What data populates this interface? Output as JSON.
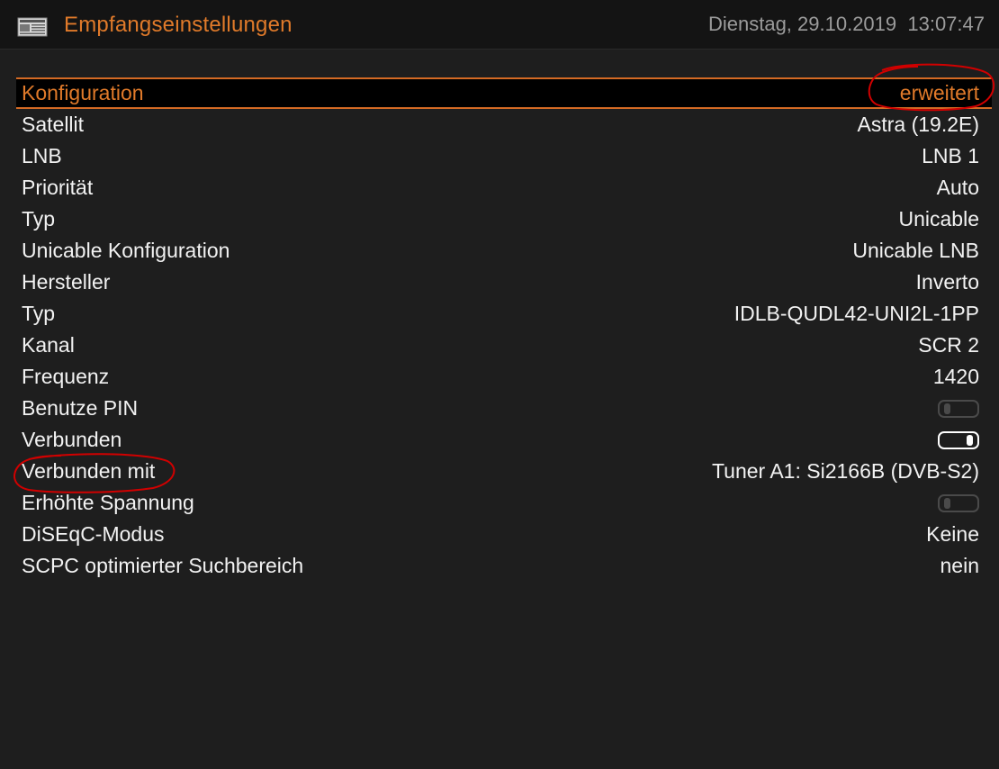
{
  "header": {
    "icon": "newspaper-icon",
    "title": "Empfangseinstellungen",
    "datetime": "Dienstag, 29.10.2019  13:07:47"
  },
  "colors": {
    "accent": "#e07a2a",
    "annotation": "#d10000",
    "background": "#1e1e1e"
  },
  "settings": [
    {
      "label": "Konfiguration",
      "value": "erweitert",
      "selected": true
    },
    {
      "label": "Satellit",
      "value": "Astra (19.2E)"
    },
    {
      "label": "LNB",
      "value": "LNB 1"
    },
    {
      "label": "Priorität",
      "value": "Auto"
    },
    {
      "label": "Typ",
      "value": "Unicable"
    },
    {
      "label": "Unicable Konfiguration",
      "value": "Unicable LNB"
    },
    {
      "label": "Hersteller",
      "value": "Inverto"
    },
    {
      "label": "Typ",
      "value": "IDLB-QUDL42-UNI2L-1PP"
    },
    {
      "label": "Kanal",
      "value": "SCR 2"
    },
    {
      "label": "Frequenz",
      "value": "1420"
    },
    {
      "label": "Benutze PIN",
      "toggle": false
    },
    {
      "label": "Verbunden",
      "toggle": true
    },
    {
      "label": "Verbunden mit",
      "value": "Tuner A1: Si2166B (DVB-S2)"
    },
    {
      "label": "Erhöhte Spannung",
      "toggle": false
    },
    {
      "label": "DiSEqC-Modus",
      "value": "Keine"
    },
    {
      "label": "SCPC optimierter Suchbereich",
      "value": "nein"
    }
  ]
}
